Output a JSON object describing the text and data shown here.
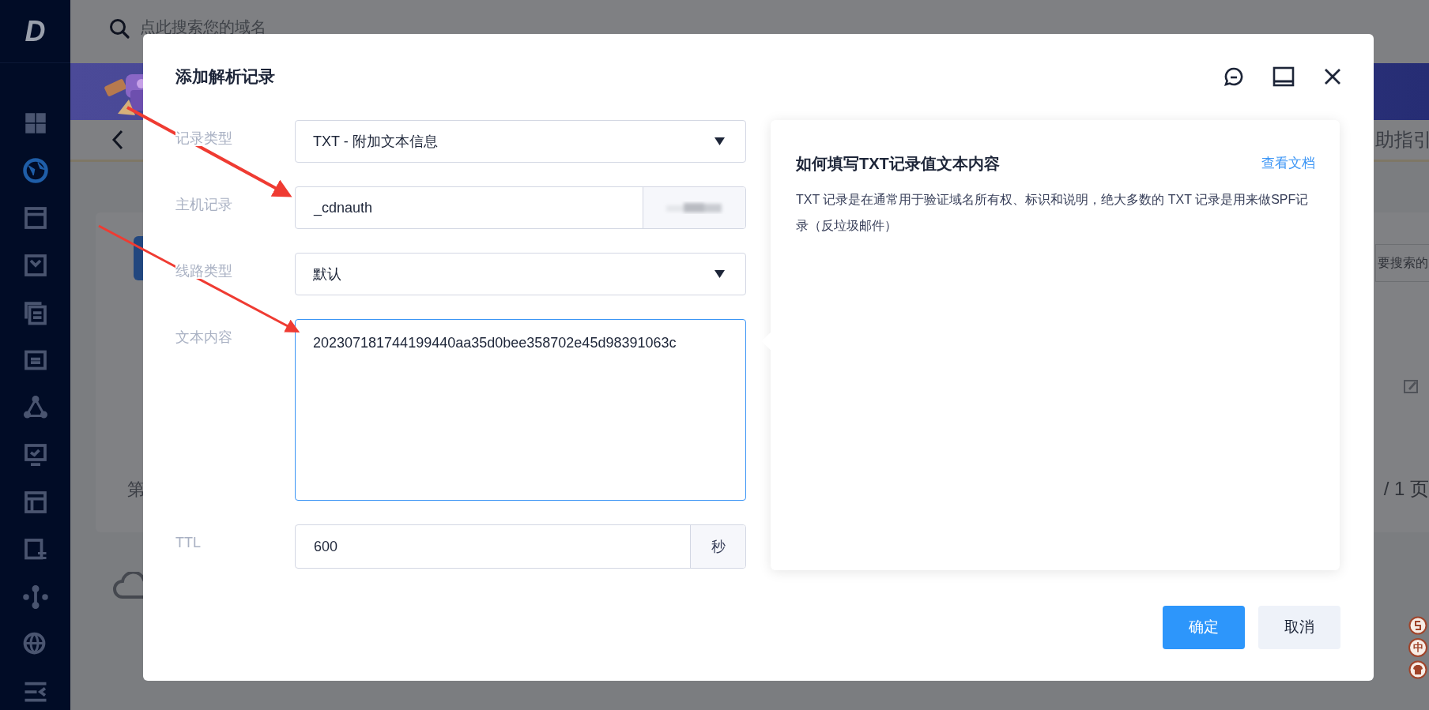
{
  "sidebar": {
    "logo": "D",
    "items": [
      {
        "selected": false
      },
      {
        "selected": true
      },
      {
        "selected": false
      },
      {
        "selected": false
      },
      {
        "selected": false
      },
      {
        "selected": false
      },
      {
        "selected": false
      },
      {
        "selected": false
      },
      {
        "selected": false
      },
      {
        "selected": false
      },
      {
        "selected": false
      },
      {
        "selected": false
      }
    ]
  },
  "topbar": {
    "search_placeholder": "点此搜索您的域名"
  },
  "page": {
    "help_link": "助指引",
    "search_placeholder": "要搜索的",
    "pagination_prefix": "第",
    "pagination_suffix": "/ 1 页"
  },
  "dialog": {
    "title": "添加解析记录",
    "fields": [
      {
        "kind": "select",
        "label": "记录类型",
        "value": "TXT - 附加文本信息",
        "focused": false
      },
      {
        "kind": "suffix",
        "label": "主机记录",
        "value": "_cdnauth",
        "focused": false
      },
      {
        "kind": "select",
        "label": "线路类型",
        "value": "默认",
        "focused": false
      },
      {
        "kind": "textarea",
        "label": "文本内容",
        "value": "202307181744199440aa35d0bee358702e45d98391063c",
        "focused": true
      },
      {
        "kind": "unit",
        "label": "TTL",
        "value": "600",
        "unit": "秒",
        "focused": false
      }
    ],
    "help": {
      "title": "如何填写TXT记录值文本内容",
      "link": "查看文档",
      "body": "TXT 记录是在通常用于验证域名所有权、标识和说明，绝大多数的 TXT 记录是用来做SPF记录（反垃圾邮件）"
    },
    "buttons": [
      {
        "kind": "primary",
        "label": "确定"
      },
      {
        "kind": "secondary",
        "label": "取消"
      }
    ]
  },
  "ime_toolbar": {
    "mode": "中"
  }
}
